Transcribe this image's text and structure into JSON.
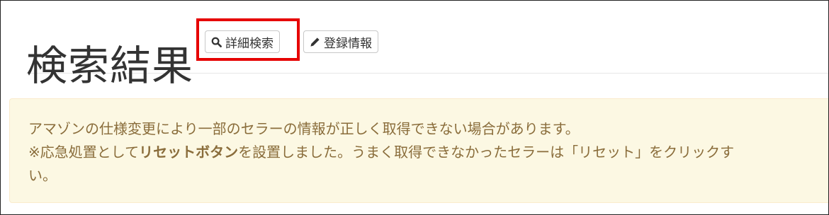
{
  "header": {
    "title": "検索結果",
    "search_button_label": "詳細検索",
    "register_button_label": "登録情報"
  },
  "alert": {
    "line1": "アマゾンの仕様変更により一部のセラーの情報が正しく取得できない場合があります。",
    "line2_prefix": "※応急処置として",
    "line2_bold": "リセットボタン",
    "line2_suffix": "を設置しました。うまく取得できなかったセラーは「リセット」をクリックす",
    "line3": "い。"
  },
  "colors": {
    "highlight": "#e60000",
    "alert_bg": "#fcf8e3",
    "alert_text": "#8a6d3b"
  },
  "icons": {
    "search_button": "search-icon",
    "register_button": "pencil-icon"
  }
}
